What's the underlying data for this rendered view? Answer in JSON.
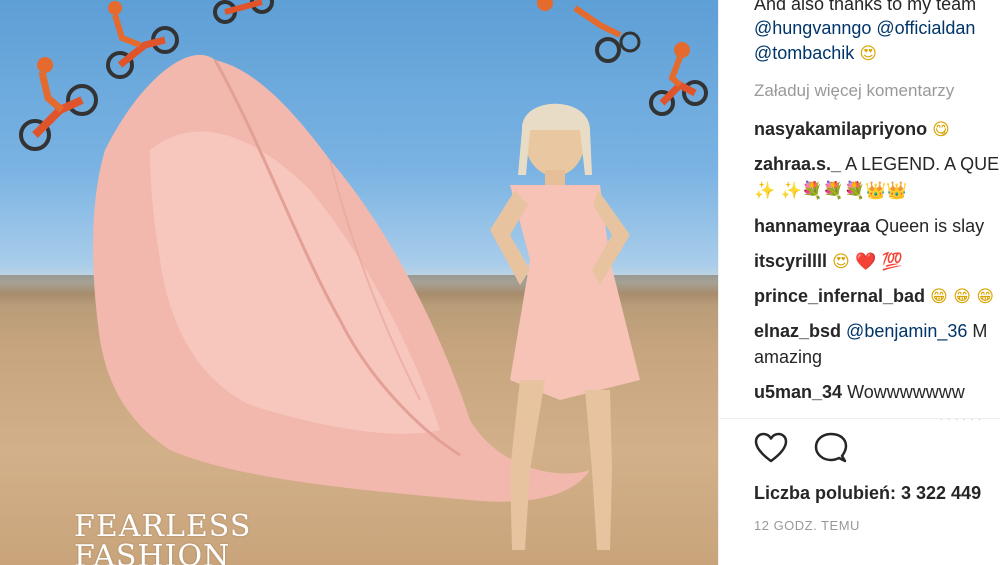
{
  "photo": {
    "caption_line1": "FEARLESS",
    "caption_line2": "FASHION"
  },
  "comments": [
    {
      "type": "text",
      "text": "And also thanks to my team"
    },
    {
      "type": "mentions",
      "mentions": [
        "@hungvanngo",
        "@officialdan"
      ]
    },
    {
      "type": "mentions_emoji",
      "mention": "@tombachik",
      "emoji": "😍"
    },
    {
      "type": "more",
      "text": "Załaduj więcej komentarzy"
    },
    {
      "user": "nasyakamilapriyono",
      "text": "",
      "emoji": "😋"
    },
    {
      "user": "zahraa.s._",
      "text": "A LEGEND. A QUE",
      "emoji_line": "✨ ✨💐💐💐👑👑"
    },
    {
      "user": "hannameyraa",
      "text": "Queen is slay"
    },
    {
      "user": "itscyrillll",
      "text": "",
      "emoji": "😍 ❤️ 💯"
    },
    {
      "user": "prince_infernal_bad",
      "text": "",
      "emoji": "😁 😁 😁"
    },
    {
      "user": "elnaz_bsd",
      "mention": "@benjamin_36",
      "text": "M",
      "text2": "amazing"
    },
    {
      "user": "u5man_34",
      "text": "Wowwwwwww"
    }
  ],
  "actions": {
    "like_icon": "heart-icon",
    "comment_icon": "comment-icon"
  },
  "likes_text": "Liczba polubień: 3 322 449",
  "time_text": "12 GODZ. TEMU"
}
